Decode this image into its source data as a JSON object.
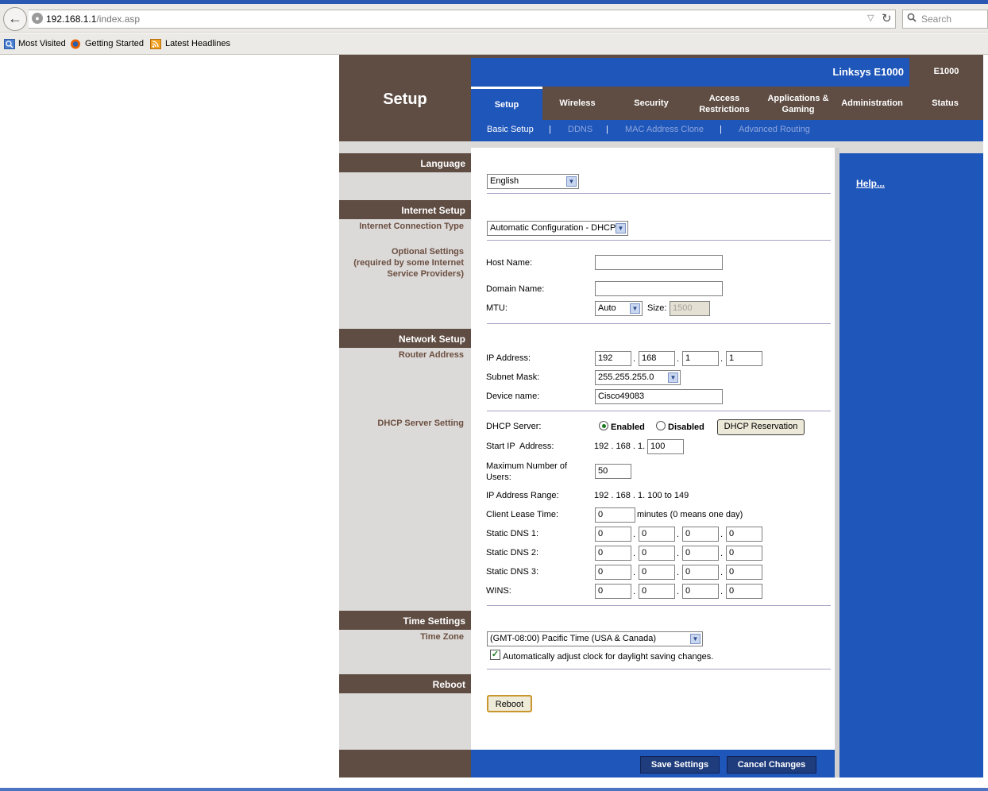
{
  "browser": {
    "url_host": "192.168.1.1",
    "url_path": "/index.asp",
    "search_placeholder": "Search",
    "bookmarks": [
      "Most Visited",
      "Getting Started",
      "Latest Headlines"
    ]
  },
  "header": {
    "title": "Setup",
    "brand": "Linksys E1000",
    "model": "E1000",
    "tabs": [
      "Setup",
      "Wireless",
      "Security",
      "Access\nRestrictions",
      "Applications &\nGaming",
      "Administration",
      "Status"
    ],
    "active_tab": "Setup",
    "subtabs": [
      "Basic Setup",
      "DDNS",
      "MAC Address Clone",
      "Advanced Routing"
    ],
    "subtab_sep": "|",
    "help_link": "Help..."
  },
  "sections": {
    "language": "Language",
    "internet_setup": "Internet Setup",
    "internet_connection_type": "Internet Connection Type",
    "optional_settings": "Optional Settings\n(required by some Internet\nService Providers)",
    "network_setup": "Network Setup",
    "router_address": "Router Address",
    "dhcp_server_setting": "DHCP Server Setting",
    "time_settings": "Time Settings",
    "time_zone": "Time Zone",
    "reboot": "Reboot"
  },
  "form": {
    "language_value": "English",
    "connection_type_value": "Automatic Configuration - DHCP",
    "host_name_label": "Host Name:",
    "host_name_value": "",
    "domain_name_label": "Domain Name:",
    "domain_name_value": "",
    "mtu_label": "MTU:",
    "mtu_value": "Auto",
    "size_label": "Size:",
    "size_value": "1500",
    "ip_address_label": "IP Address:",
    "ip_address": [
      "192",
      "168",
      "1",
      "1"
    ],
    "subnet_mask_label": "Subnet Mask:",
    "subnet_mask_value": "255.255.255.0",
    "device_name_label": "Device name:",
    "device_name_value": "Cisco49083",
    "dhcp_server_label": "DHCP Server:",
    "dhcp_enabled_label": "Enabled",
    "dhcp_disabled_label": "Disabled",
    "dhcp_reservation_label": "DHCP Reservation",
    "start_ip_label": "Start IP  Address:",
    "start_ip_prefix": "192 . 168 . 1.",
    "start_ip_value": "100",
    "max_users_label": "Maximum Number of\n Users:",
    "max_users_value": "50",
    "ip_range_label": "IP Address Range:",
    "ip_range_value": "192 . 168 . 1. 100 to 149",
    "lease_label": "Client Lease Time:",
    "lease_value": "0",
    "lease_suffix": "minutes (0 means one day)",
    "dns1_label": "Static DNS 1:",
    "dns1": [
      "0",
      "0",
      "0",
      "0"
    ],
    "dns2_label": "Static DNS 2:",
    "dns2": [
      "0",
      "0",
      "0",
      "0"
    ],
    "dns3_label": "Static DNS 3:",
    "dns3": [
      "0",
      "0",
      "0",
      "0"
    ],
    "wins_label": "WINS:",
    "wins": [
      "0",
      "0",
      "0",
      "0"
    ],
    "timezone_value": "(GMT-08:00) Pacific Time (USA & Canada)",
    "dst_label": "Automatically adjust clock for daylight saving changes.",
    "dst_checked": true,
    "reboot_button": "Reboot"
  },
  "footer": {
    "save_button": "Save Settings",
    "cancel_button": "Cancel Changes"
  }
}
